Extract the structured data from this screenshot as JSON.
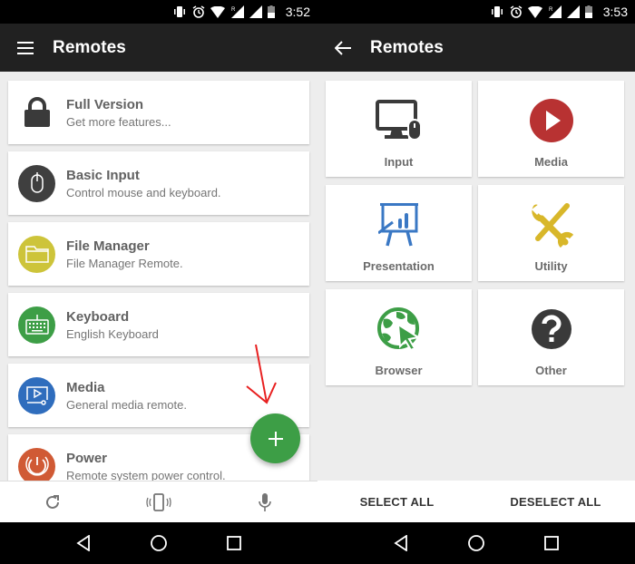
{
  "left": {
    "status": {
      "time": "3:52"
    },
    "appbar": {
      "title": "Remotes",
      "nav_icon": "menu-icon"
    },
    "remotes": [
      {
        "name": "Full Version",
        "description": "Get more features...",
        "icon": "lock-icon",
        "color": ""
      },
      {
        "name": "Basic Input",
        "description": "Control mouse and keyboard.",
        "icon": "mouse-icon",
        "color": "#3f3f3f"
      },
      {
        "name": "File Manager",
        "description": "File Manager Remote.",
        "icon": "folder-icon",
        "color": "#cdc43a"
      },
      {
        "name": "Keyboard",
        "description": "English Keyboard",
        "icon": "keyboard-icon",
        "color": "#3d9e46"
      },
      {
        "name": "Media",
        "description": "General media remote.",
        "icon": "media-icon",
        "color": "#2f6dbd"
      },
      {
        "name": "Power",
        "description": "Remote system power control.",
        "icon": "power-icon",
        "color": "#d05a35"
      }
    ],
    "fab": {
      "icon": "plus-icon",
      "color": "#3d9e46"
    },
    "bottom_actions": [
      {
        "icon": "refresh-icon"
      },
      {
        "icon": "vibrate-phone-icon"
      },
      {
        "icon": "microphone-icon"
      }
    ]
  },
  "right": {
    "status": {
      "time": "3:53"
    },
    "appbar": {
      "title": "Remotes",
      "nav_icon": "back-arrow-icon"
    },
    "categories": [
      {
        "label": "Input",
        "icon": "monitor-mouse-icon",
        "color": "#3a3a3a"
      },
      {
        "label": "Media",
        "icon": "play-circle-icon",
        "color": "#b83232"
      },
      {
        "label": "Presentation",
        "icon": "presentation-icon",
        "color": "#3a78c4"
      },
      {
        "label": "Utility",
        "icon": "tools-icon",
        "color": "#d8b72a"
      },
      {
        "label": "Browser",
        "icon": "globe-cursor-icon",
        "color": "#3d9e46"
      },
      {
        "label": "Other",
        "icon": "question-circle-icon",
        "color": "#3a3a3a"
      }
    ],
    "actions": {
      "select_all": "SELECT ALL",
      "deselect_all": "DESELECT ALL"
    }
  },
  "system_nav": {
    "back": "back-icon",
    "home": "home-icon",
    "recents": "recents-icon"
  }
}
